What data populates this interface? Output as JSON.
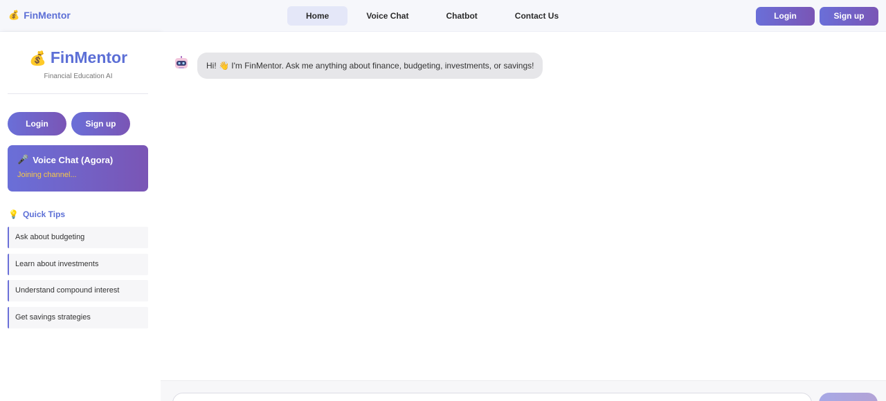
{
  "header": {
    "brand_icon": "money-bag-icon",
    "brand_emoji": "💰",
    "brand_name": "FinMentor",
    "nav": [
      {
        "label": "Home",
        "active": true
      },
      {
        "label": "Voice Chat",
        "active": false
      },
      {
        "label": "Chatbot",
        "active": false
      },
      {
        "label": "Contact Us",
        "active": false
      }
    ],
    "login_label": "Login",
    "signup_label": "Sign up"
  },
  "sidebar": {
    "title_emoji": "💰",
    "title": "FinMentor",
    "subtitle": "Financial Education AI",
    "login_label": "Login",
    "signup_label": "Sign up",
    "voice_card": {
      "icon": "microphone-icon",
      "emoji": "🎤",
      "title": "Voice Chat (Agora)",
      "status": "Joining channel..."
    },
    "tips_heading_emoji": "💡",
    "tips_heading": "Quick Tips",
    "tips": [
      "Ask about budgeting",
      "Learn about investments",
      "Understand compound interest",
      "Get savings strategies"
    ]
  },
  "chat": {
    "messages": [
      {
        "sender": "bot",
        "avatar": "robot-icon",
        "text": "Hi! 👋 I'm FinMentor. Ask me anything about finance, budgeting, investments, or savings!"
      }
    ]
  },
  "input": {
    "placeholder": "",
    "send_label": ""
  },
  "colors": {
    "accent": "#5c6fd6",
    "gradient_start": "#6a6fd8",
    "gradient_end": "#7a55b5",
    "status_yellow": "#f7c948"
  }
}
